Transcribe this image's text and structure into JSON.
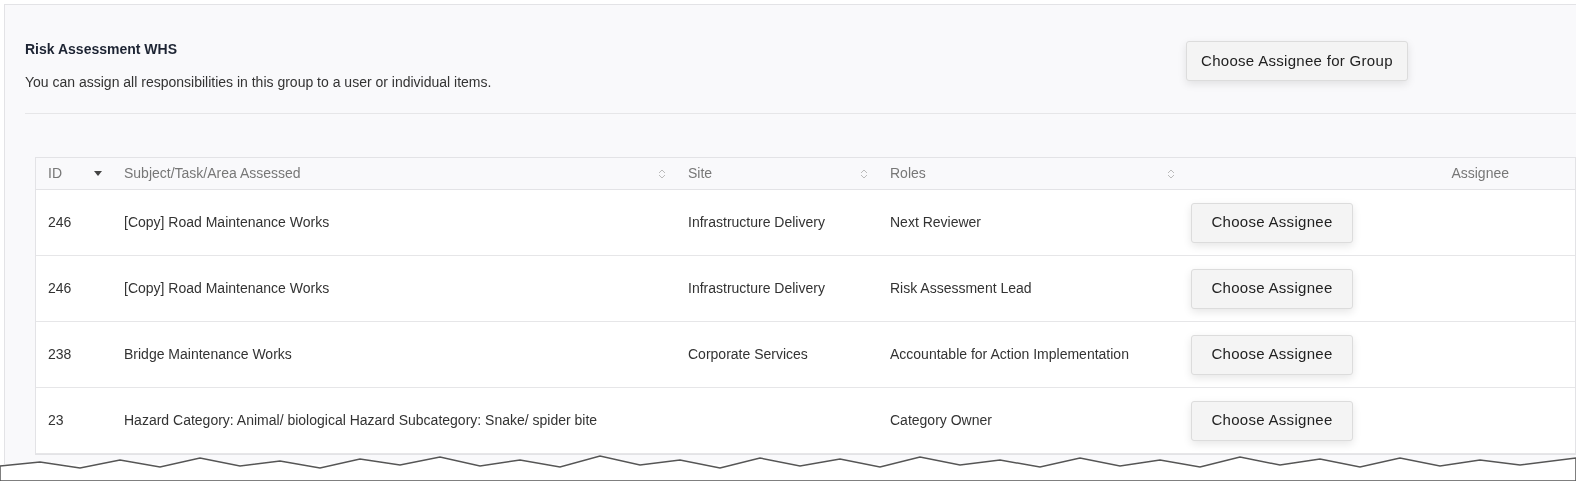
{
  "header": {
    "title": "Risk Assessment WHS",
    "description": "You can assign all responsibilities in this group to a user or individual items.",
    "group_button": "Choose Assignee for Group"
  },
  "table": {
    "columns": [
      {
        "label": "ID",
        "sortable": true,
        "sorted": true
      },
      {
        "label": "Subject/Task/Area Assessed",
        "sortable": true,
        "sorted": false
      },
      {
        "label": "Site",
        "sortable": true,
        "sorted": false
      },
      {
        "label": "Roles",
        "sortable": true,
        "sorted": false
      },
      {
        "label": "Assignee",
        "sortable": false
      }
    ],
    "rows": [
      {
        "id": "246",
        "subject": "[Copy] Road Maintenance Works",
        "site": "Infrastructure Delivery",
        "role": "Next Reviewer",
        "button": "Choose Assignee"
      },
      {
        "id": "246",
        "subject": "[Copy] Road Maintenance Works",
        "site": "Infrastructure Delivery",
        "role": "Risk Assessment Lead",
        "button": "Choose Assignee"
      },
      {
        "id": "238",
        "subject": "Bridge Maintenance Works",
        "site": "Corporate Services",
        "role": "Accountable for Action Implementation",
        "button": "Choose Assignee"
      },
      {
        "id": "23",
        "subject": "Hazard Category: Animal/ biological Hazard Subcategory: Snake/ spider bite",
        "role": "Category Owner",
        "button": "Choose Assignee"
      }
    ]
  }
}
